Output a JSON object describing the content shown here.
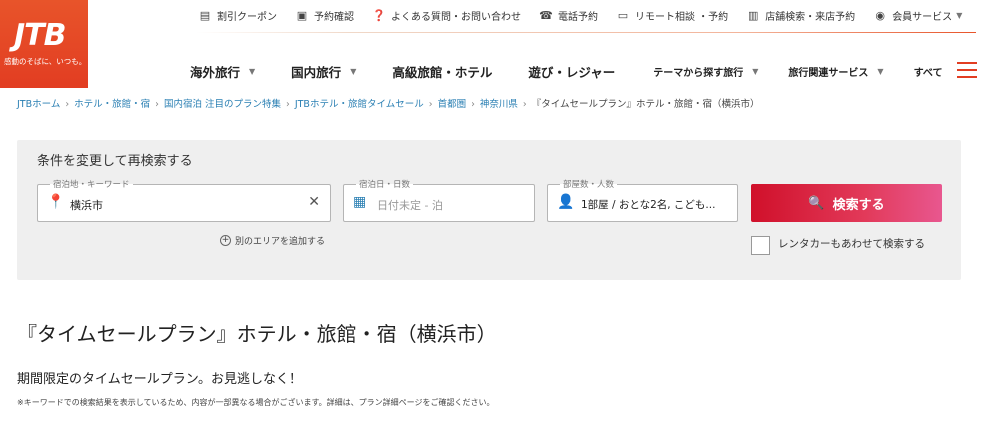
{
  "logo": {
    "mark": "JTB",
    "tagline": "感動のそばに、いつも。"
  },
  "utility": [
    {
      "label": "割引クーポン",
      "icon": "coupon-icon",
      "glyph": "▤",
      "chev": false
    },
    {
      "label": "予約確認",
      "icon": "calendar-check-icon",
      "glyph": "▣",
      "chev": false
    },
    {
      "label": "よくある質問・お問い合わせ",
      "icon": "question-icon",
      "glyph": "❓",
      "chev": false
    },
    {
      "label": "電話予約",
      "icon": "phone-icon",
      "glyph": "☎",
      "chev": false
    },
    {
      "label": "リモート相談 ・予約",
      "icon": "remote-icon",
      "glyph": "▭",
      "chev": false
    },
    {
      "label": "店舗検索・来店予約",
      "icon": "store-icon",
      "glyph": "▥",
      "chev": false
    },
    {
      "label": "会員サービス",
      "icon": "member-icon",
      "glyph": "◉",
      "chev": true
    }
  ],
  "nav": [
    {
      "label": "海外旅行",
      "size": "big",
      "chev": true
    },
    {
      "label": "国内旅行",
      "size": "big",
      "chev": true
    },
    {
      "label": "高級旅館・ホテル",
      "size": "big",
      "chev": false
    },
    {
      "label": "遊び・レジャー",
      "size": "big",
      "chev": false
    },
    {
      "label": "テーマから探す旅行",
      "size": "small",
      "chev": true
    },
    {
      "label": "旅行関連サービス",
      "size": "small",
      "chev": true
    },
    {
      "label": "すべて",
      "size": "small",
      "chev": false
    }
  ],
  "breadcrumb": [
    "JTBホーム",
    "ホテル・旅館・宿",
    "国内宿泊 注目のプラン特集",
    "JTBホテル・旅館タイムセール",
    "首都圏",
    "神奈川県"
  ],
  "breadcrumb_current": "『タイムセールプラン』ホテル・旅館・宿（横浜市）",
  "search": {
    "title": "条件を変更して再検索する",
    "location_label": "宿泊地・キーワード",
    "location_value": "横浜市",
    "date_label": "宿泊日・日数",
    "date_value": "日付未定 - 泊",
    "guests_label": "部屋数・人数",
    "guests_value": "1部屋 / おとな2名, こども...",
    "add_area": "別のエリアを追加する",
    "button": "検索する",
    "rental_car": "レンタカーもあわせて検索する"
  },
  "page": {
    "heading": "『タイムセールプラン』ホテル・旅館・宿（横浜市）",
    "lead": "期間限定のタイムセールプラン。お見逃しなく！",
    "note": "※キーワードでの検索結果を表示しているため、内容が一部異なる場合がございます。詳細は、プラン詳細ページをご確認ください。"
  }
}
